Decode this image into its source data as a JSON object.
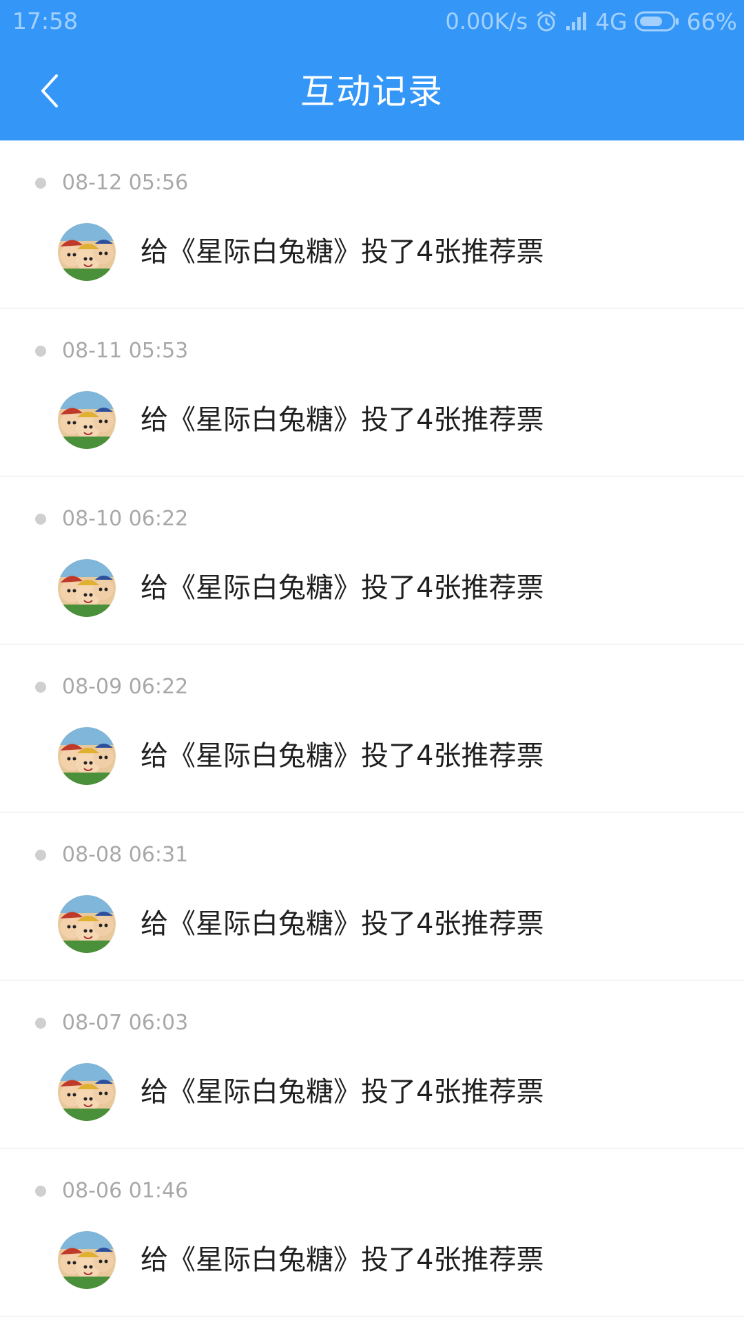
{
  "colors": {
    "header_bg": "#3497f8",
    "title_text": "#ffffff",
    "timestamp_text": "#a8a8a8",
    "record_text": "#1f1f1f",
    "timeline_dot": "#cfcfcf",
    "divider": "#e9e9e9"
  },
  "status_bar": {
    "time": "17:58",
    "network_speed": "0.00K/s",
    "alarm_icon": "alarm-clock-icon",
    "signal_icon": "cell-signal-icon",
    "network_type": "4G",
    "battery_icon": "battery-icon",
    "battery_percent": "66%"
  },
  "nav": {
    "back_icon": "chevron-left-icon",
    "title": "互动记录"
  },
  "records": [
    {
      "time": "08-12 05:56",
      "text": "给《星际白兔糖》投了4张推荐票",
      "avatar_icon": "user-avatar"
    },
    {
      "time": "08-11 05:53",
      "text": "给《星际白兔糖》投了4张推荐票",
      "avatar_icon": "user-avatar"
    },
    {
      "time": "08-10 06:22",
      "text": "给《星际白兔糖》投了4张推荐票",
      "avatar_icon": "user-avatar"
    },
    {
      "time": "08-09 06:22",
      "text": "给《星际白兔糖》投了4张推荐票",
      "avatar_icon": "user-avatar"
    },
    {
      "time": "08-08 06:31",
      "text": "给《星际白兔糖》投了4张推荐票",
      "avatar_icon": "user-avatar"
    },
    {
      "time": "08-07 06:03",
      "text": "给《星际白兔糖》投了4张推荐票",
      "avatar_icon": "user-avatar"
    },
    {
      "time": "08-06 01:46",
      "text": "给《星际白兔糖》投了4张推荐票",
      "avatar_icon": "user-avatar"
    }
  ]
}
